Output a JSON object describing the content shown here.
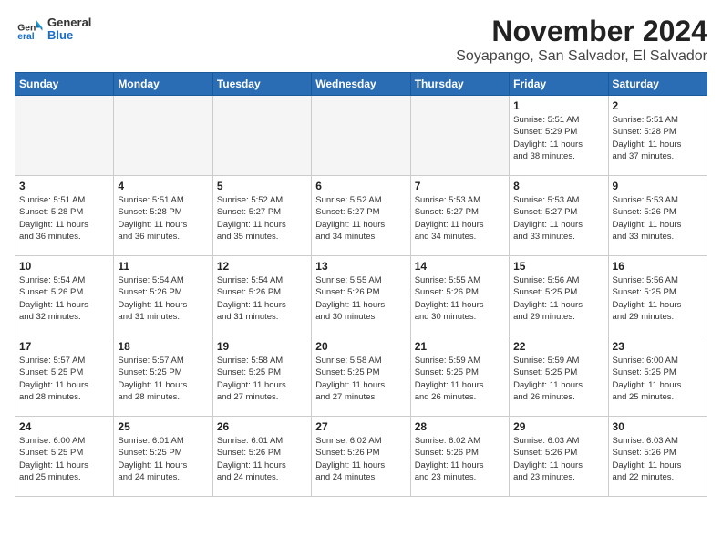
{
  "header": {
    "logo": {
      "general": "General",
      "blue": "Blue"
    },
    "month_title": "November 2024",
    "location": "Soyapango, San Salvador, El Salvador"
  },
  "weekdays": [
    "Sunday",
    "Monday",
    "Tuesday",
    "Wednesday",
    "Thursday",
    "Friday",
    "Saturday"
  ],
  "weeks": [
    [
      {
        "day": "",
        "info": ""
      },
      {
        "day": "",
        "info": ""
      },
      {
        "day": "",
        "info": ""
      },
      {
        "day": "",
        "info": ""
      },
      {
        "day": "",
        "info": ""
      },
      {
        "day": "1",
        "info": "Sunrise: 5:51 AM\nSunset: 5:29 PM\nDaylight: 11 hours\nand 38 minutes."
      },
      {
        "day": "2",
        "info": "Sunrise: 5:51 AM\nSunset: 5:28 PM\nDaylight: 11 hours\nand 37 minutes."
      }
    ],
    [
      {
        "day": "3",
        "info": "Sunrise: 5:51 AM\nSunset: 5:28 PM\nDaylight: 11 hours\nand 36 minutes."
      },
      {
        "day": "4",
        "info": "Sunrise: 5:51 AM\nSunset: 5:28 PM\nDaylight: 11 hours\nand 36 minutes."
      },
      {
        "day": "5",
        "info": "Sunrise: 5:52 AM\nSunset: 5:27 PM\nDaylight: 11 hours\nand 35 minutes."
      },
      {
        "day": "6",
        "info": "Sunrise: 5:52 AM\nSunset: 5:27 PM\nDaylight: 11 hours\nand 34 minutes."
      },
      {
        "day": "7",
        "info": "Sunrise: 5:53 AM\nSunset: 5:27 PM\nDaylight: 11 hours\nand 34 minutes."
      },
      {
        "day": "8",
        "info": "Sunrise: 5:53 AM\nSunset: 5:27 PM\nDaylight: 11 hours\nand 33 minutes."
      },
      {
        "day": "9",
        "info": "Sunrise: 5:53 AM\nSunset: 5:26 PM\nDaylight: 11 hours\nand 33 minutes."
      }
    ],
    [
      {
        "day": "10",
        "info": "Sunrise: 5:54 AM\nSunset: 5:26 PM\nDaylight: 11 hours\nand 32 minutes."
      },
      {
        "day": "11",
        "info": "Sunrise: 5:54 AM\nSunset: 5:26 PM\nDaylight: 11 hours\nand 31 minutes."
      },
      {
        "day": "12",
        "info": "Sunrise: 5:54 AM\nSunset: 5:26 PM\nDaylight: 11 hours\nand 31 minutes."
      },
      {
        "day": "13",
        "info": "Sunrise: 5:55 AM\nSunset: 5:26 PM\nDaylight: 11 hours\nand 30 minutes."
      },
      {
        "day": "14",
        "info": "Sunrise: 5:55 AM\nSunset: 5:26 PM\nDaylight: 11 hours\nand 30 minutes."
      },
      {
        "day": "15",
        "info": "Sunrise: 5:56 AM\nSunset: 5:25 PM\nDaylight: 11 hours\nand 29 minutes."
      },
      {
        "day": "16",
        "info": "Sunrise: 5:56 AM\nSunset: 5:25 PM\nDaylight: 11 hours\nand 29 minutes."
      }
    ],
    [
      {
        "day": "17",
        "info": "Sunrise: 5:57 AM\nSunset: 5:25 PM\nDaylight: 11 hours\nand 28 minutes."
      },
      {
        "day": "18",
        "info": "Sunrise: 5:57 AM\nSunset: 5:25 PM\nDaylight: 11 hours\nand 28 minutes."
      },
      {
        "day": "19",
        "info": "Sunrise: 5:58 AM\nSunset: 5:25 PM\nDaylight: 11 hours\nand 27 minutes."
      },
      {
        "day": "20",
        "info": "Sunrise: 5:58 AM\nSunset: 5:25 PM\nDaylight: 11 hours\nand 27 minutes."
      },
      {
        "day": "21",
        "info": "Sunrise: 5:59 AM\nSunset: 5:25 PM\nDaylight: 11 hours\nand 26 minutes."
      },
      {
        "day": "22",
        "info": "Sunrise: 5:59 AM\nSunset: 5:25 PM\nDaylight: 11 hours\nand 26 minutes."
      },
      {
        "day": "23",
        "info": "Sunrise: 6:00 AM\nSunset: 5:25 PM\nDaylight: 11 hours\nand 25 minutes."
      }
    ],
    [
      {
        "day": "24",
        "info": "Sunrise: 6:00 AM\nSunset: 5:25 PM\nDaylight: 11 hours\nand 25 minutes."
      },
      {
        "day": "25",
        "info": "Sunrise: 6:01 AM\nSunset: 5:25 PM\nDaylight: 11 hours\nand 24 minutes."
      },
      {
        "day": "26",
        "info": "Sunrise: 6:01 AM\nSunset: 5:26 PM\nDaylight: 11 hours\nand 24 minutes."
      },
      {
        "day": "27",
        "info": "Sunrise: 6:02 AM\nSunset: 5:26 PM\nDaylight: 11 hours\nand 24 minutes."
      },
      {
        "day": "28",
        "info": "Sunrise: 6:02 AM\nSunset: 5:26 PM\nDaylight: 11 hours\nand 23 minutes."
      },
      {
        "day": "29",
        "info": "Sunrise: 6:03 AM\nSunset: 5:26 PM\nDaylight: 11 hours\nand 23 minutes."
      },
      {
        "day": "30",
        "info": "Sunrise: 6:03 AM\nSunset: 5:26 PM\nDaylight: 11 hours\nand 22 minutes."
      }
    ]
  ]
}
